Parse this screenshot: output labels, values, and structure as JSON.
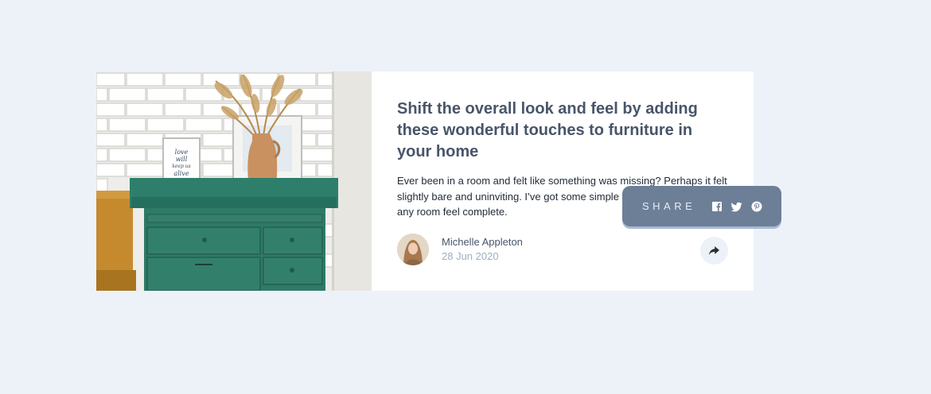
{
  "article": {
    "title": "Shift the overall look and feel by adding these wonderful touches to furniture in your home",
    "excerpt": "Ever been in a room and felt like something was missing? Perhaps it felt slightly bare and uninviting. I’ve got some simple tips to help you make any room feel complete.",
    "author_name": "Michelle Appleton",
    "date": "28 Jun 2020"
  },
  "share": {
    "label": "SHARE",
    "icons": [
      "facebook-icon",
      "twitter-icon",
      "pinterest-icon"
    ]
  },
  "colors": {
    "background": "#ECF2F8",
    "title": "#48556A",
    "popup": "#6D7F97",
    "muted": "#9DAEC2"
  }
}
